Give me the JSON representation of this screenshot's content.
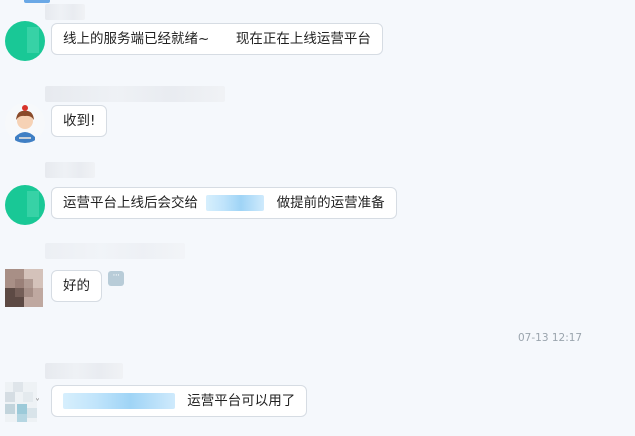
{
  "messages": [
    {
      "sender": "user-green-1",
      "text_part1": "线上的服务端已经就绪~",
      "text_part2": "现在正在上线运营平台"
    },
    {
      "sender": "user-cartoon",
      "text": "收到!"
    },
    {
      "sender": "user-green-2",
      "text_part1": "运营平台上线后会交给",
      "text_part2": "做提前的运营准备"
    },
    {
      "sender": "user-photo",
      "text": "好的",
      "more_icon": "more-options-icon",
      "more_glyph": "···"
    },
    {
      "sender": "user-pixel",
      "text": "运营平台可以用了"
    }
  ],
  "timestamp": "07-13 12:17",
  "colors": {
    "background": "#f5f8fc",
    "bubble": "#ffffff",
    "bubble_border": "#d6dce3",
    "avatar_green": "#19c896",
    "mention": "#9fd4f6",
    "timestamp": "#9aa4ad"
  }
}
